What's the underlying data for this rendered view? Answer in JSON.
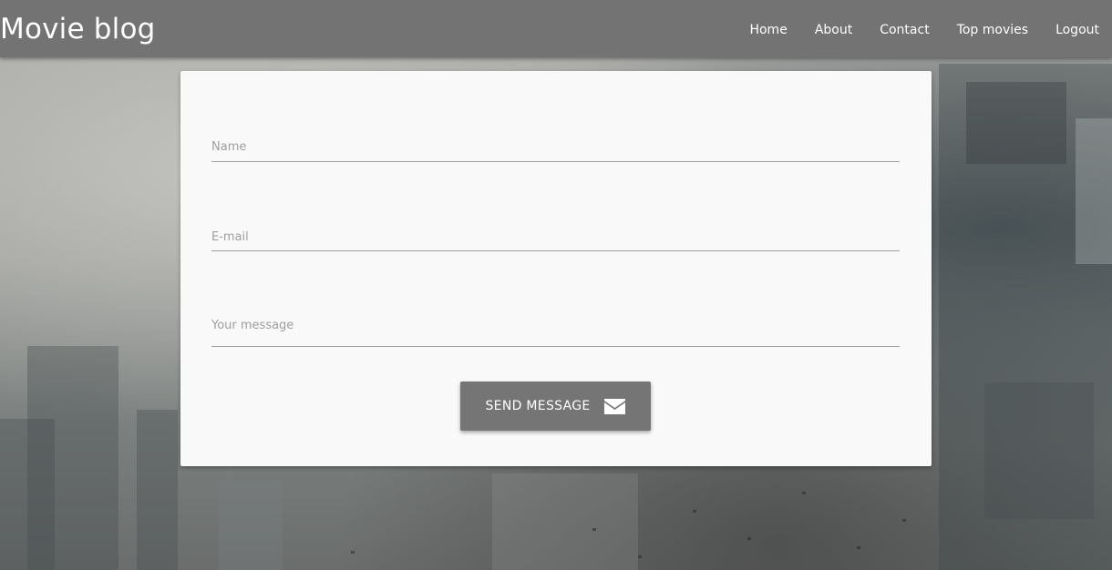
{
  "navbar": {
    "brand": "Movie blog",
    "links": [
      {
        "label": "Home"
      },
      {
        "label": "About"
      },
      {
        "label": "Contact"
      },
      {
        "label": "Top movies"
      },
      {
        "label": "Logout"
      }
    ]
  },
  "contact_form": {
    "name": {
      "placeholder": "Name",
      "value": ""
    },
    "email": {
      "placeholder": "E-mail",
      "value": ""
    },
    "message": {
      "placeholder": "Your message",
      "value": ""
    },
    "submit_label": "SEND MESSAGE",
    "submit_icon": "envelope-icon"
  },
  "colors": {
    "navbar_bg": "#737373",
    "card_bg": "#f9f9f9",
    "button_bg": "#757575",
    "placeholder": "#9e9e9e"
  }
}
